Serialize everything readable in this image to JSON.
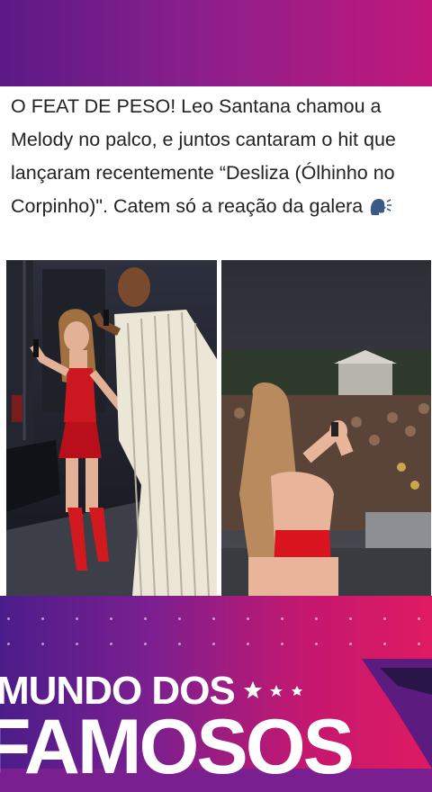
{
  "post": {
    "caption": "O FEAT DE PESO! Leo Santana chamou a Melody no palco, e juntos cantaram o hit que lançaram recentemente “Desliza (Ólhinho no Corpinho)\". Catem só a reação da galera",
    "caption_icon": "speaking-head-icon"
  },
  "brand": {
    "line1": "MUNDO DOS",
    "line2": "FAMOSOS",
    "stars": "★ ★ ★"
  },
  "colors": {
    "band_purple": "#5b1a86",
    "band_pink": "#c2187a",
    "outfit_red": "#d9141e"
  }
}
